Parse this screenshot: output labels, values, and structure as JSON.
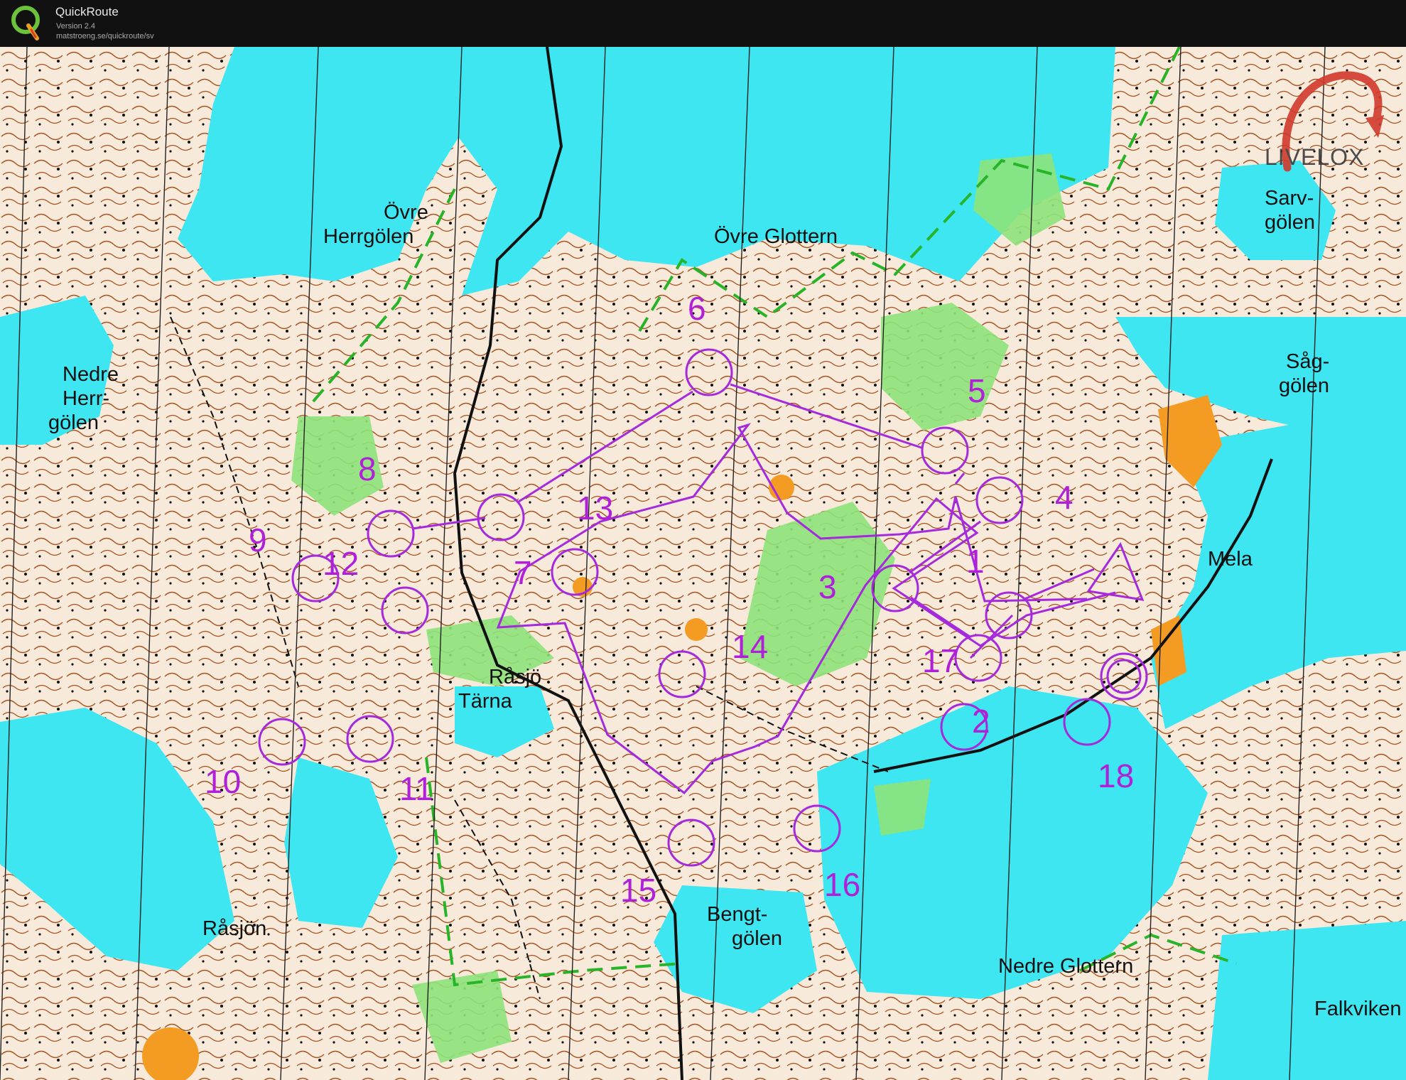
{
  "app": {
    "title": "QuickRoute",
    "version": "Version 2.4",
    "url": "matstroeng.se/quickroute/sv",
    "logo_icon": "quickroute-q-logo"
  },
  "watermark": {
    "text": "LIVELOX",
    "color": "#d1392b"
  },
  "colors": {
    "water": "#3ee6f2",
    "land": "#f7eadb",
    "green": "#8de37a",
    "contour": "#a8521e",
    "course": "#a52adb",
    "orange": "#f49b23"
  },
  "place_names": [
    {
      "id": "ovre-herrgolen",
      "lines": [
        "Övre",
        "Herrgölen"
      ]
    },
    {
      "id": "ovre-glottern",
      "lines": [
        "Övre Glottern"
      ]
    },
    {
      "id": "nedre-herrgolen",
      "lines": [
        "Nedre",
        "Herr-",
        "gölen"
      ]
    },
    {
      "id": "sarvgolen",
      "lines": [
        "Sarv-",
        "gölen"
      ]
    },
    {
      "id": "saggolen",
      "lines": [
        "Såg-",
        "gölen"
      ]
    },
    {
      "id": "mela",
      "lines": [
        "Mela"
      ]
    },
    {
      "id": "rasjo-tarna",
      "lines": [
        "Råsjö",
        "Tärna"
      ]
    },
    {
      "id": "rasjon",
      "lines": [
        "Råsjön"
      ]
    },
    {
      "id": "bengtgolen",
      "lines": [
        "Bengt-",
        "gölen"
      ]
    },
    {
      "id": "nedre-glottern",
      "lines": [
        "Nedre Glottern"
      ]
    },
    {
      "id": "falkviken",
      "lines": [
        "Falkviken"
      ]
    }
  ],
  "course": {
    "start_label": "start",
    "finish_label": "finish",
    "controls": [
      {
        "n": "1"
      },
      {
        "n": "2"
      },
      {
        "n": "3"
      },
      {
        "n": "4"
      },
      {
        "n": "5"
      },
      {
        "n": "6"
      },
      {
        "n": "7"
      },
      {
        "n": "8"
      },
      {
        "n": "9"
      },
      {
        "n": "10"
      },
      {
        "n": "11"
      },
      {
        "n": "12"
      },
      {
        "n": "13"
      },
      {
        "n": "14"
      },
      {
        "n": "15"
      },
      {
        "n": "16"
      },
      {
        "n": "17"
      },
      {
        "n": "18"
      }
    ]
  }
}
